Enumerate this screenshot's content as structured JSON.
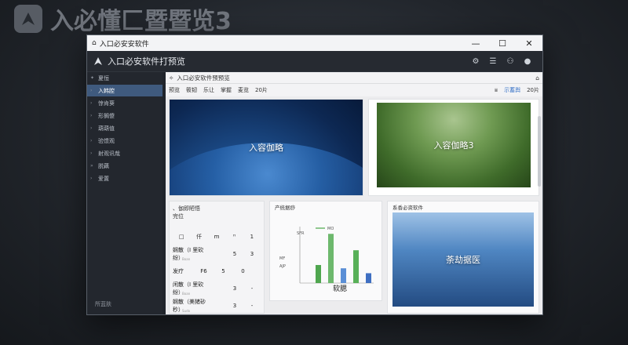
{
  "background": {
    "title": "入必懂匚暨暨览3"
  },
  "window": {
    "title": "入口必安安软件",
    "controls": {
      "minimize": "—",
      "maximize": "☐",
      "close": "✕"
    }
  },
  "app": {
    "name": "入口必安软件打预览",
    "header_icons": [
      "gear-icon",
      "menu-icon",
      "people-icon",
      "user-icon"
    ]
  },
  "sidebar": {
    "items": [
      {
        "label": "夏恒",
        "active": false
      },
      {
        "label": "入韩腔",
        "active": true
      },
      {
        "label": "惊肯葵",
        "active": false
      },
      {
        "label": "形搁傻",
        "active": false
      },
      {
        "label": "葫葫值",
        "active": false
      },
      {
        "label": "验馈观",
        "active": false
      },
      {
        "label": "射观讯哉",
        "active": false
      },
      {
        "label": "脱藕",
        "active": false
      },
      {
        "label": "爱置",
        "active": false
      }
    ],
    "footer": "所蓝肤"
  },
  "breadcrumb": {
    "title": "入口必安软件预预览"
  },
  "toolbar": {
    "items": [
      "预览",
      "筱韧",
      "乐让",
      "掌握",
      "麦览",
      "20片"
    ],
    "right_label": "示蓄舆",
    "right_count": "20片"
  },
  "cards": {
    "earth": {
      "label": "入容伽略"
    },
    "fern": {
      "label": "入容伽略3"
    },
    "table": {
      "caption_lines": [
        "、伽即陋悟",
        "完位"
      ],
      "header": [
        "□",
        "仟",
        "m",
        "ᴴ",
        "1"
      ],
      "rows": [
        {
          "name": "娴散（I 里砍纷）",
          "sub": "Boan",
          "v1": "5",
          "v2": "3"
        },
        {
          "name": "发疗",
          "sub": "",
          "v0": "F6",
          "v1": "5",
          "v2": "0"
        },
        {
          "name": "闲散（I 里砍纷）",
          "sub": "Boan",
          "v1": "3",
          "v2": "-"
        },
        {
          "name": "娴散（美猪砂秒）",
          "sub": "Sudo",
          "v1": "3",
          "v2": "-"
        }
      ]
    },
    "chart": {
      "title": "产统据痧",
      "center_label": "软腮"
    },
    "cubes": {
      "title": "系香必资软件",
      "label": "荼劫据医"
    }
  },
  "chart_data": {
    "type": "bar",
    "title": "产统据痧",
    "legend": [
      "MO"
    ],
    "tick_labels": [
      "SFR",
      "MF",
      "AJP"
    ],
    "values": [
      22,
      60,
      18,
      40,
      12
    ],
    "colors": [
      "#4fa64f",
      "#6db86d",
      "#5b8fd6",
      "#58b058",
      "#3f6fc2"
    ]
  }
}
